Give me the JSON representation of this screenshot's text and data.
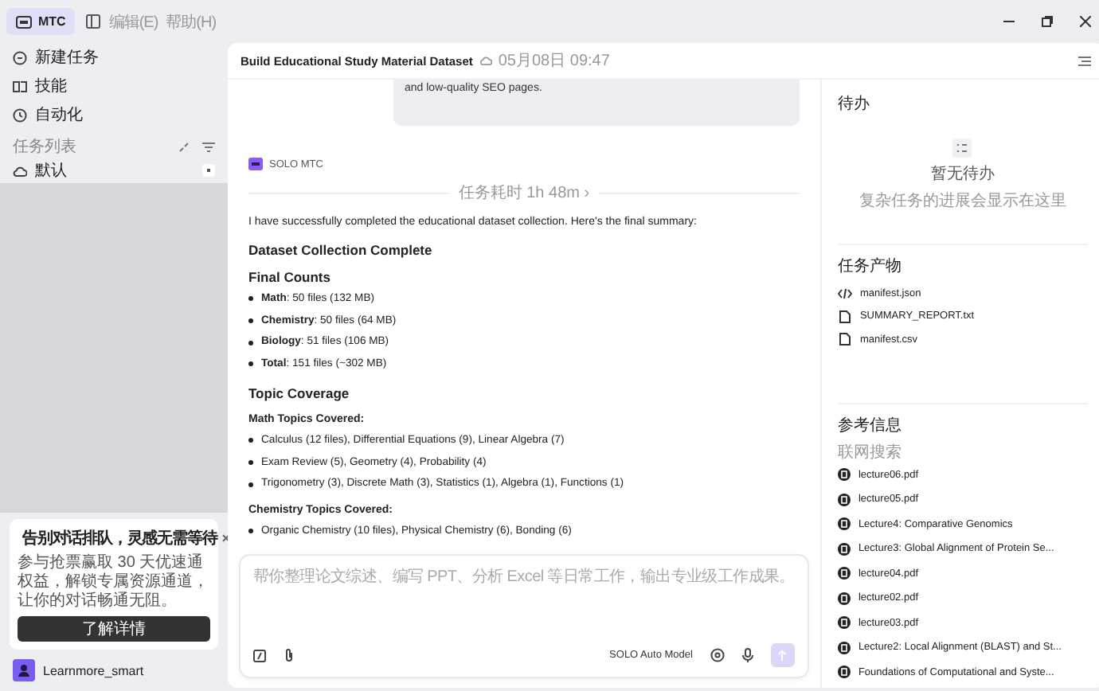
{
  "titlebar": {
    "app": "MTC",
    "app_selected": true,
    "menus": [
      "编辑(E)",
      "帮助(H)"
    ]
  },
  "sidebar": {
    "nav": [
      {
        "label": "新建任务",
        "kind": "new"
      },
      {
        "label": "技能",
        "kind": "skills"
      },
      {
        "label": "自动化",
        "kind": "auto"
      }
    ],
    "section_title": "任务列表",
    "tasks": [
      {
        "label": "默认",
        "selected": false
      }
    ]
  },
  "promo": {
    "title": "告别对话排队，灵感无需等待",
    "close": "×",
    "body": "参与抢票赢取 30 天优速通权益，解锁专属资源通道，让你的对话畅通无阻。",
    "button": "了解详情"
  },
  "user": {
    "name": "Learnmore_smart"
  },
  "task": {
    "title": "Build Educational Study Material Dataset",
    "date": "05月08日 09:47"
  },
  "chat": {
    "user_message": "and low-quality SEO pages.",
    "agent": "SOLO MTC",
    "duration": "任务耗时 1h 48m ›",
    "blocks": [
      {
        "kind": "p",
        "text": "I have successfully completed the educational dataset collection. Here's the final summary:"
      },
      {
        "kind": "h2",
        "text": "Dataset Collection Complete"
      },
      {
        "kind": "h3",
        "text": "Final Counts"
      },
      {
        "kind": "li",
        "text": "**Math**: 50 files (132 MB)"
      },
      {
        "kind": "li",
        "text": "**Chemistry**: 50 files (64 MB)"
      },
      {
        "kind": "li",
        "text": "**Biology**: 51 files (106 MB)"
      },
      {
        "kind": "li",
        "text": "**Total**: 151 files (~302 MB)"
      },
      {
        "kind": "h2",
        "text": "Topic Coverage"
      },
      {
        "kind": "h4",
        "text": "Math Topics Covered:"
      },
      {
        "kind": "li",
        "text": "Calculus (12 files), Differential Equations (9), Linear Algebra (7)"
      },
      {
        "kind": "li",
        "text": "Exam Review (5), Geometry (4), Probability (4)"
      },
      {
        "kind": "li",
        "text": "Trigonometry (3), Discrete Math (3), Statistics (1), Algebra (1), Functions (1)"
      },
      {
        "kind": "h4",
        "text": "Chemistry Topics Covered:"
      },
      {
        "kind": "li",
        "text": "Organic Chemistry (10 files), Physical Chemistry (6), Bonding (6)"
      }
    ]
  },
  "composer": {
    "placeholder": "帮你整理论文综述、编写 PPT、分析 Excel 等日常工作，输出专业级工作成果。",
    "model": "SOLO Auto Model"
  },
  "todo": {
    "title": "待办",
    "empty_title": "暂无待办",
    "empty_hint": "复杂任务的进展会显示在这里"
  },
  "artifacts": {
    "title": "任务产物",
    "files": [
      {
        "name": "manifest.json",
        "kind": "code"
      },
      {
        "name": "SUMMARY_REPORT.txt",
        "kind": "file"
      },
      {
        "name": "manifest.csv",
        "kind": "file"
      }
    ]
  },
  "references": {
    "title": "参考信息",
    "subtitle": "联网搜索",
    "items": [
      "lecture06.pdf",
      "lecture05.pdf",
      "Lecture4: Comparative Genomics",
      "Lecture3: Global Alignment of Protein Se...",
      "lecture04.pdf",
      "lecture02.pdf",
      "lecture03.pdf",
      "Lecture2: Local Alignment (BLAST) and St...",
      "Foundations of Computational and Syste..."
    ]
  }
}
